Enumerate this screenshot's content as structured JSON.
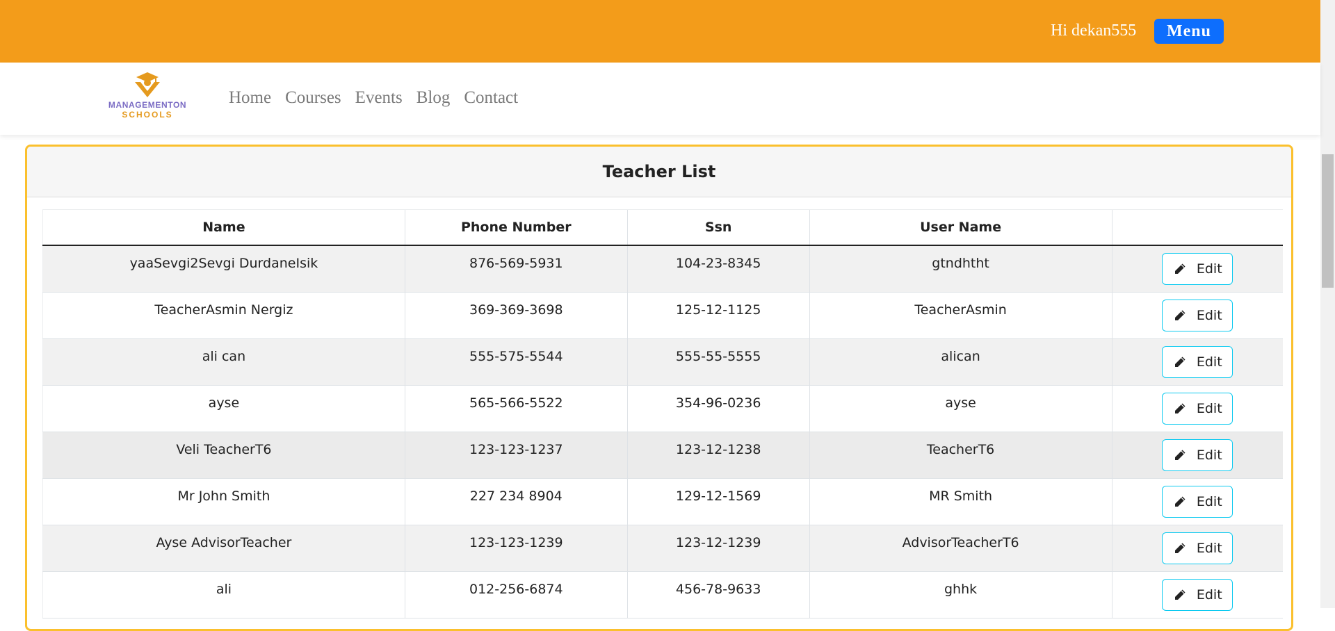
{
  "header": {
    "greeting": "Hi dekan555",
    "menu_label": "Menu",
    "brand_color": "#f39c1a"
  },
  "logo": {
    "line1": "MANAGEMENTON",
    "line2": "SCHOOLS"
  },
  "nav": {
    "items": [
      "Home",
      "Courses",
      "Events",
      "Blog",
      "Contact"
    ]
  },
  "card": {
    "title": "Teacher List"
  },
  "table": {
    "headers": [
      "Name",
      "Phone Number",
      "Ssn",
      "User Name",
      ""
    ],
    "edit_label": "Edit",
    "rows": [
      {
        "name": "yaaSevgi2Sevgi DurdaneIsik",
        "phone": "876-569-5931",
        "ssn": "104-23-8345",
        "username": "gtndhtht"
      },
      {
        "name": "TeacherAsmin Nergiz",
        "phone": "369-369-3698",
        "ssn": "125-12-1125",
        "username": "TeacherAsmin"
      },
      {
        "name": "ali can",
        "phone": "555-575-5544",
        "ssn": "555-55-5555",
        "username": "alican"
      },
      {
        "name": "ayse",
        "phone": "565-566-5522",
        "ssn": "354-96-0236",
        "username": "ayse"
      },
      {
        "name": "Veli TeacherT6",
        "phone": "123-123-1237",
        "ssn": "123-12-1238",
        "username": "TeacherT6"
      },
      {
        "name": "Mr John Smith",
        "phone": "227 234 8904",
        "ssn": "129-12-1569",
        "username": "MR Smith"
      },
      {
        "name": "Ayse AdvisorTeacher",
        "phone": "123-123-1239",
        "ssn": "123-12-1239",
        "username": "AdvisorTeacherT6"
      },
      {
        "name": "ali",
        "phone": "012-256-6874",
        "ssn": "456-78-9633",
        "username": "ghhk"
      }
    ]
  }
}
